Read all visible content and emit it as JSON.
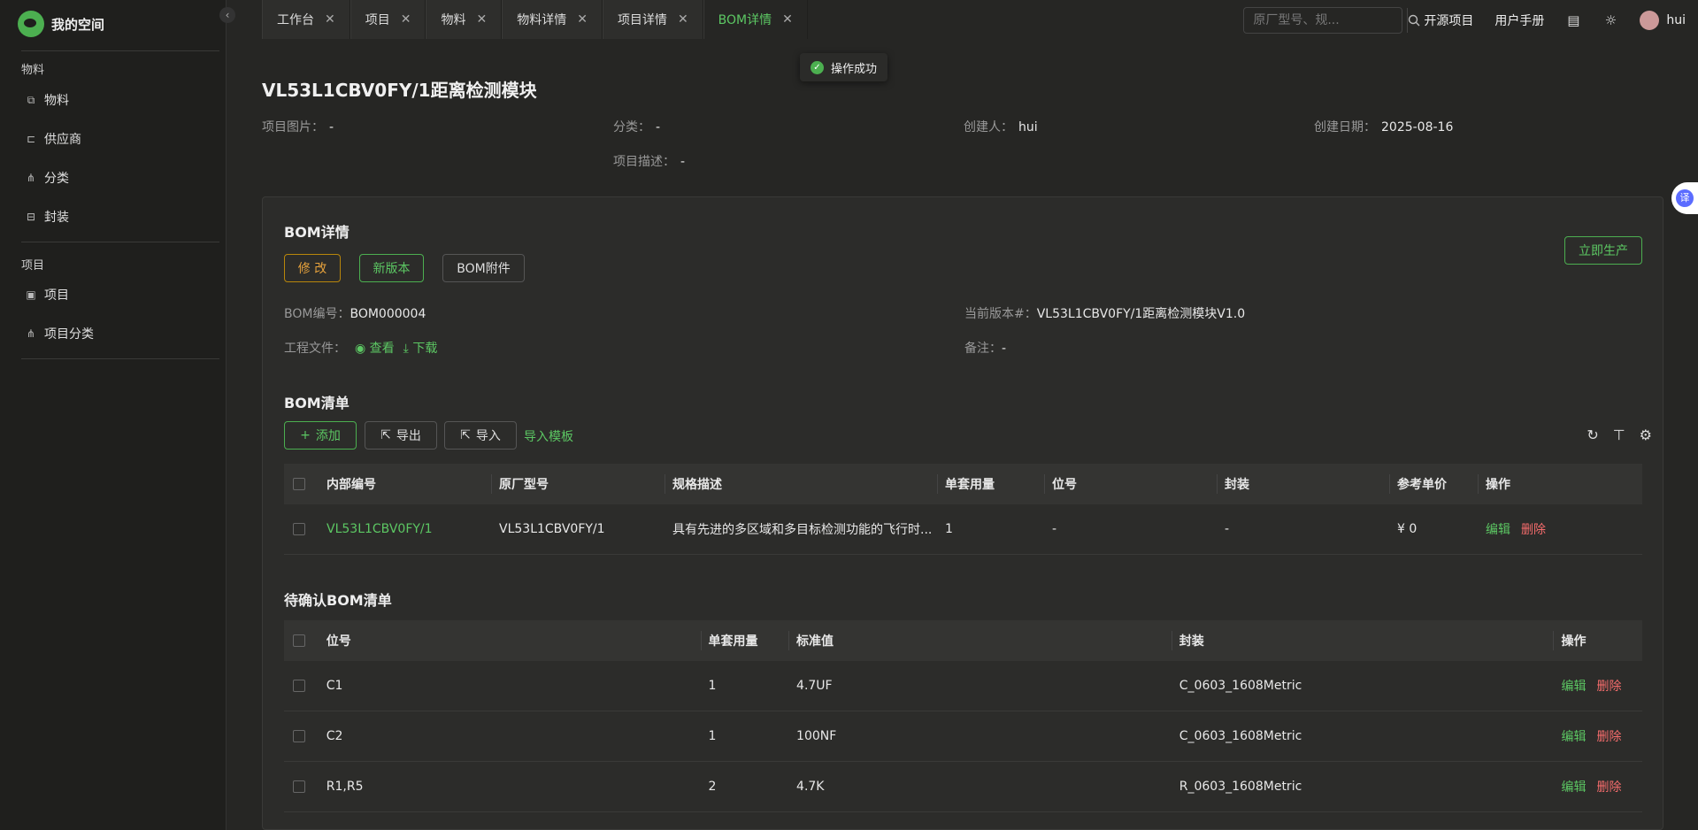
{
  "app": {
    "title": "我的空间"
  },
  "sidebar": {
    "groups": [
      {
        "label": "物料",
        "items": [
          {
            "label": "物料",
            "icon": "material-icon"
          },
          {
            "label": "供应商",
            "icon": "supplier-icon"
          },
          {
            "label": "分类",
            "icon": "category-icon"
          },
          {
            "label": "封装",
            "icon": "package-icon"
          }
        ]
      },
      {
        "label": "项目",
        "items": [
          {
            "label": "项目",
            "icon": "project-icon"
          },
          {
            "label": "项目分类",
            "icon": "project-category-icon"
          }
        ]
      }
    ]
  },
  "tabs": [
    {
      "label": "工作台",
      "active": false
    },
    {
      "label": "项目",
      "active": false
    },
    {
      "label": "物料",
      "active": false
    },
    {
      "label": "物料详情",
      "active": false
    },
    {
      "label": "项目详情",
      "active": false
    },
    {
      "label": "BOM详情",
      "active": true
    }
  ],
  "header": {
    "search_placeholder": "原厂型号、规...",
    "links": [
      "开源项目",
      "用户手册"
    ],
    "username": "hui"
  },
  "toast": {
    "text": "操作成功"
  },
  "project": {
    "title": "VL53L1CBV0FY/1距离检测模块",
    "image_label": "项目图片：",
    "image_value": "-",
    "category_label": "分类：",
    "category_value": "-",
    "creator_label": "创建人：",
    "creator_value": "hui",
    "date_label": "创建日期：",
    "date_value": "2025-08-16",
    "desc_label": "项目描述：",
    "desc_value": "-"
  },
  "bom": {
    "title": "BOM详情",
    "buttons": {
      "edit": "修 改",
      "new_version": "新版本",
      "attachment": "BOM附件",
      "produce": "立即生产"
    },
    "number_label": "BOM编号：",
    "number_value": "BOM000004",
    "version_label": "当前版本#：",
    "version_value": "VL53L1CBV0FY/1距离检测模块V1.0",
    "files_label": "工程文件：",
    "view": "查看",
    "download": "下载",
    "remark_label": "备注：",
    "remark_value": "-"
  },
  "bom_list": {
    "title": "BOM清单",
    "buttons": {
      "add": "添加",
      "export": "导出",
      "import": "导入",
      "template": "导入模板"
    },
    "columns": [
      "内部编号",
      "原厂型号",
      "规格描述",
      "单套用量",
      "位号",
      "封装",
      "参考单价",
      "操作"
    ],
    "rows": [
      {
        "code": "VL53L1CBV0FY/1",
        "mpn": "VL53L1CBV0FY/1",
        "desc": "具有先进的多区域和多目标检测功能的飞行时...",
        "qty": "1",
        "ref": "-",
        "pkg": "-",
        "price": "¥ 0",
        "edit": "编辑",
        "delete": "删除"
      }
    ]
  },
  "pending_list": {
    "title": "待确认BOM清单",
    "columns": [
      "位号",
      "单套用量",
      "标准值",
      "封装",
      "操作"
    ],
    "rows": [
      {
        "ref": "C1",
        "qty": "1",
        "value": "4.7UF",
        "pkg": "C_0603_1608Metric",
        "edit": "编辑",
        "delete": "删除"
      },
      {
        "ref": "C2",
        "qty": "1",
        "value": "100NF",
        "pkg": "C_0603_1608Metric",
        "edit": "编辑",
        "delete": "删除"
      },
      {
        "ref": "R1,R5",
        "qty": "2",
        "value": "4.7K",
        "pkg": "R_0603_1608Metric",
        "edit": "编辑",
        "delete": "删除"
      }
    ]
  },
  "translate_badge": "译"
}
